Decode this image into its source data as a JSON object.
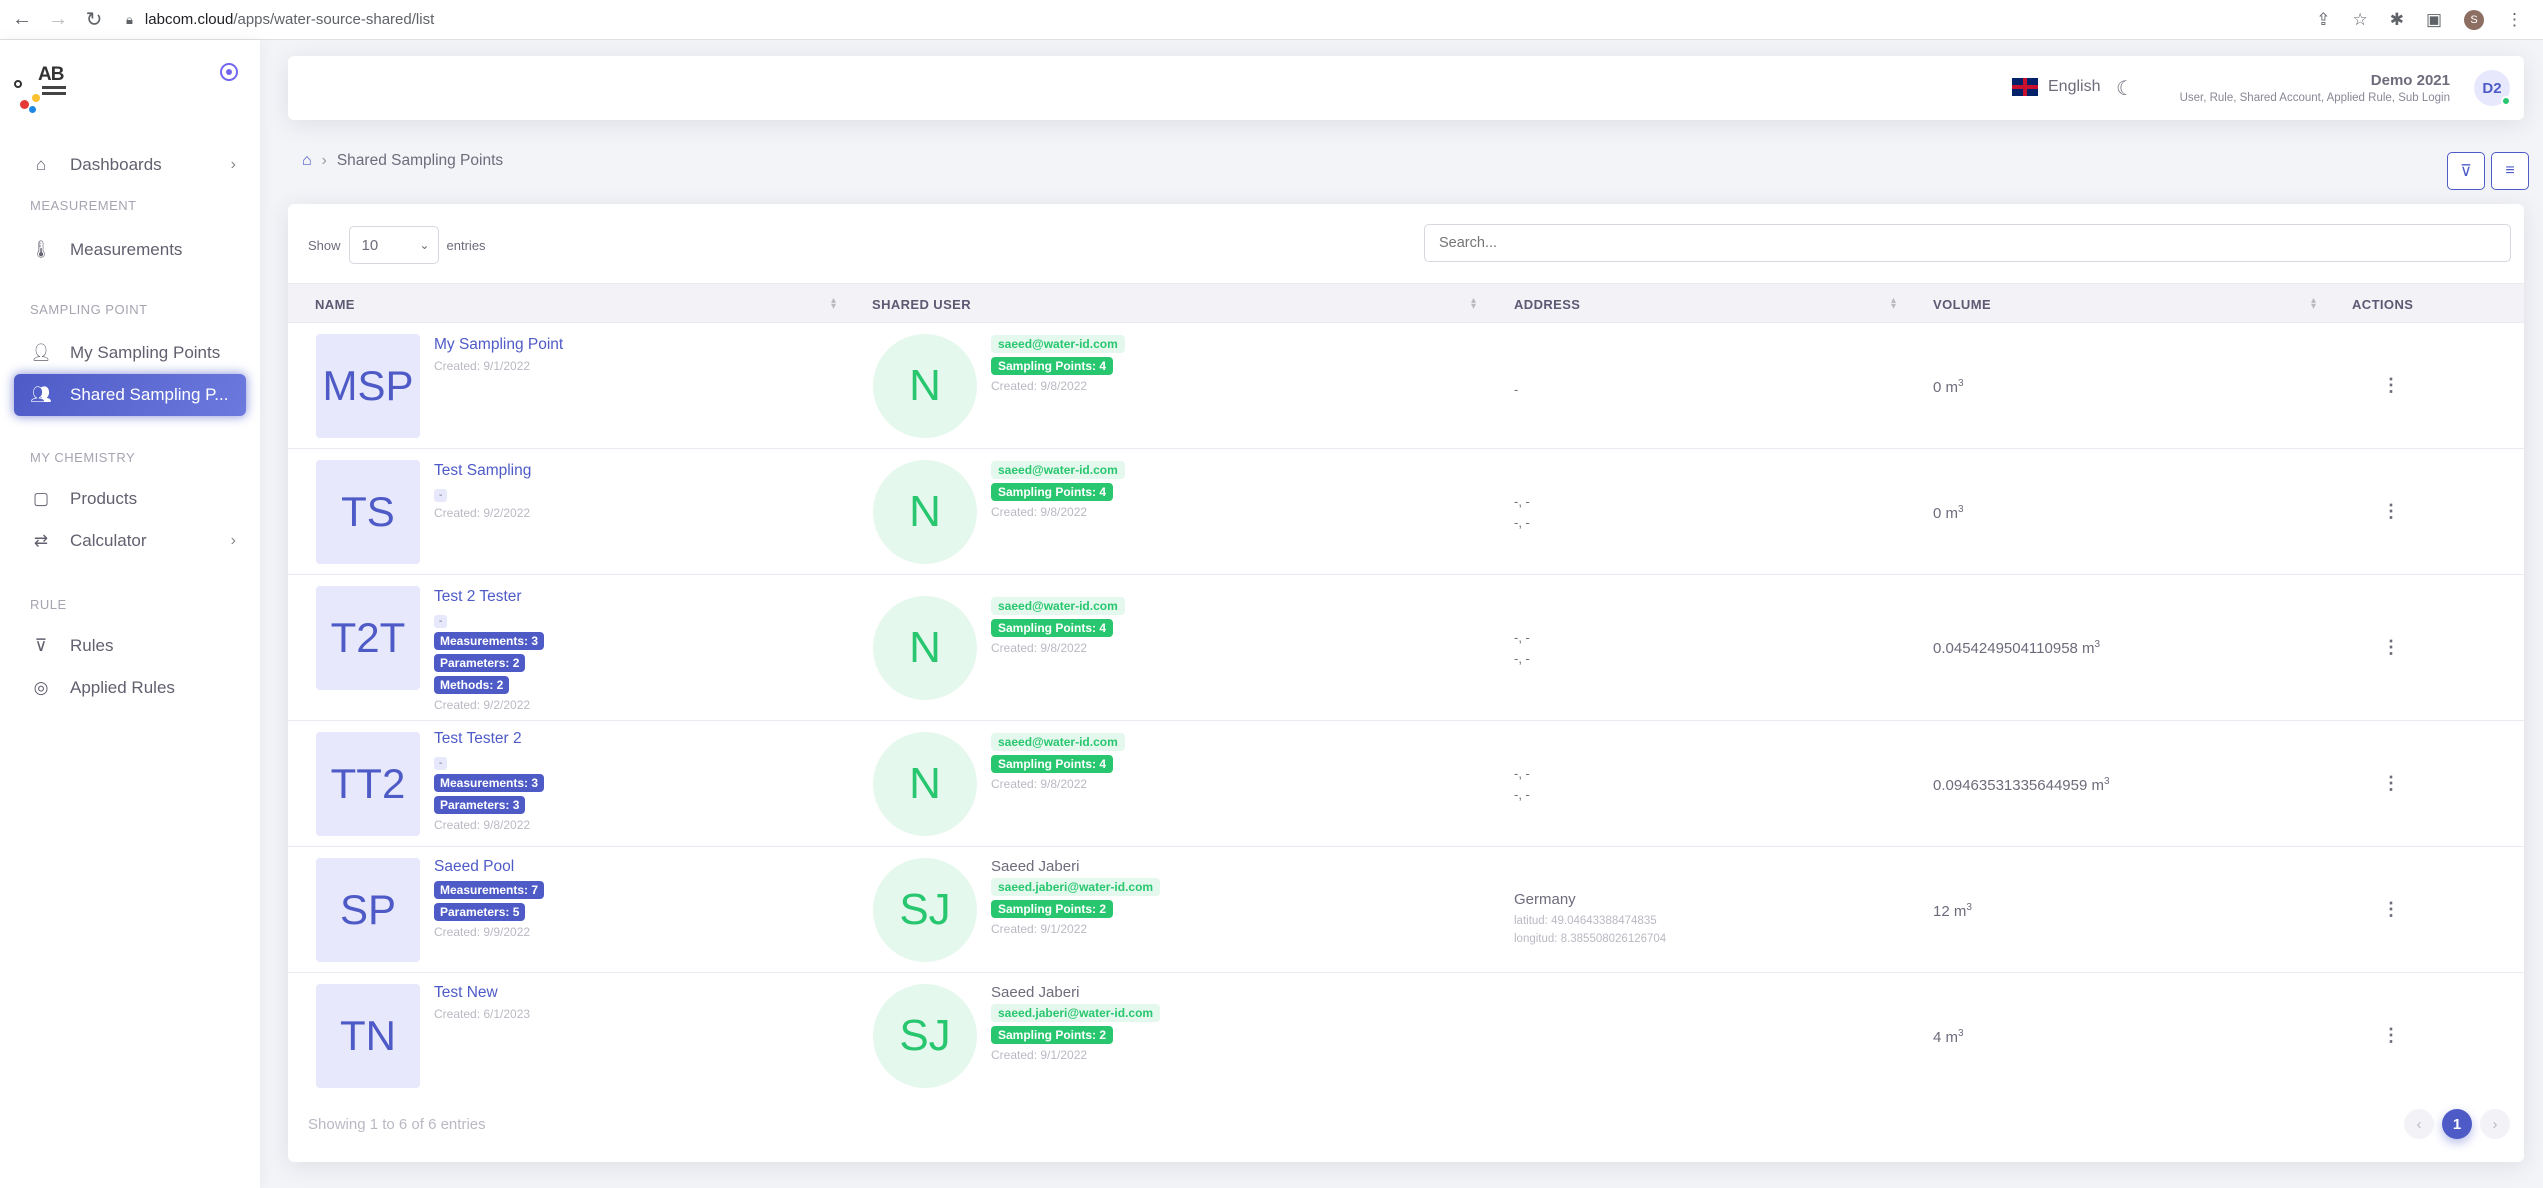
{
  "browser": {
    "url_host": "labcom.cloud",
    "url_path": "/apps/water-source-shared/list",
    "profile_initial": "S"
  },
  "sidebar": {
    "sections": {
      "measurement": "MEASUREMENT",
      "sampling_point": "SAMPLING POINT",
      "my_chemistry": "MY CHEMISTRY",
      "rule": "RULE"
    },
    "items": {
      "dashboards": "Dashboards",
      "measurements": "Measurements",
      "my_sampling_points": "My Sampling Points",
      "shared_sampling_points": "Shared Sampling P...",
      "products": "Products",
      "calculator": "Calculator",
      "rules": "Rules",
      "applied_rules": "Applied Rules"
    }
  },
  "header": {
    "language": "English",
    "user_name": "Demo 2021",
    "user_roles": "User, Rule, Shared Account, Applied Rule, Sub Login",
    "avatar_initials": "D2"
  },
  "breadcrumb": {
    "current": "Shared Sampling Points"
  },
  "table": {
    "show_label": "Show",
    "entries_label": "entries",
    "page_size": "10",
    "search_placeholder": "Search...",
    "columns": {
      "name": "NAME",
      "shared_user": "SHARED USER",
      "address": "ADDRESS",
      "volume": "VOLUME",
      "actions": "ACTIONS"
    },
    "rows": [
      {
        "initials": "MSP",
        "name": "My Sampling Point",
        "created": "Created: 9/1/2022",
        "user_initial": "N",
        "user_email": "saeed@water-id.com",
        "user_points": "Sampling Points: 4",
        "user_created": "Created: 9/8/2022",
        "address_line": "-",
        "volume_value": "0 m",
        "volume_unit_sup": "3"
      },
      {
        "initials": "TS",
        "name": "Test Sampling",
        "dash": "-",
        "created": "Created: 9/2/2022",
        "user_initial": "N",
        "user_email": "saeed@water-id.com",
        "user_points": "Sampling Points: 4",
        "user_created": "Created: 9/8/2022",
        "address_1": "-, -",
        "address_2": "-, -",
        "volume_value": "0 m",
        "volume_unit_sup": "3"
      },
      {
        "initials": "T2T",
        "name": "Test 2 Tester",
        "dash": "-",
        "badge_measurements": "Measurements: 3",
        "badge_parameters": "Parameters: 2",
        "badge_methods": "Methods: 2",
        "created": "Created: 9/2/2022",
        "user_initial": "N",
        "user_email": "saeed@water-id.com",
        "user_points": "Sampling Points: 4",
        "user_created": "Created: 9/8/2022",
        "address_1": "-, -",
        "address_2": "-, -",
        "volume_value": "0.0454249504110958 m",
        "volume_unit_sup": "3"
      },
      {
        "initials": "TT2",
        "name": "Test Tester 2",
        "dash": "-",
        "badge_measurements": "Measurements: 3",
        "badge_parameters": "Parameters: 3",
        "created": "Created: 9/8/2022",
        "user_initial": "N",
        "user_email": "saeed@water-id.com",
        "user_points": "Sampling Points: 4",
        "user_created": "Created: 9/8/2022",
        "address_1": "-, -",
        "address_2": "-, -",
        "volume_value": "0.09463531335644959 m",
        "volume_unit_sup": "3"
      },
      {
        "initials": "SP",
        "name": "Saeed Pool",
        "badge_measurements": "Measurements: 7",
        "badge_parameters": "Parameters: 5",
        "created": "Created: 9/9/2022",
        "user_initial": "SJ",
        "user_name": "Saeed Jaberi",
        "user_email": "saeed.jaberi@water-id.com",
        "user_points": "Sampling Points: 2",
        "user_created": "Created: 9/1/2022",
        "address_country": "Germany",
        "address_lat": "latitud: 49.04643388474835",
        "address_lng": "longitud: 8.385508026126704",
        "volume_value": "12 m",
        "volume_unit_sup": "3"
      },
      {
        "initials": "TN",
        "name": "Test New",
        "created": "Created: 6/1/2023",
        "user_initial": "SJ",
        "user_name": "Saeed Jaberi",
        "user_email": "saeed.jaberi@water-id.com",
        "user_points": "Sampling Points: 2",
        "user_created": "Created: 9/1/2022",
        "volume_value": "4 m",
        "volume_unit_sup": "3"
      }
    ],
    "footer": "Showing 1 to 6 of 6 entries",
    "current_page": "1"
  },
  "icons": {
    "home": "home-icon",
    "thermometer": "thermometer-icon",
    "user": "user-icon",
    "users": "users-icon",
    "product": "bag-icon",
    "calculator": "repeat-icon",
    "rules": "filter-icon",
    "applied": "target-icon",
    "filter": "filter-icon",
    "menu": "menu-icon",
    "moon": "moon-icon"
  },
  "colors": {
    "primary": "#4e5bc7",
    "success": "#28c76f",
    "avatar_bg": "#e7e8fb",
    "success_bg": "#e5f8ed"
  }
}
